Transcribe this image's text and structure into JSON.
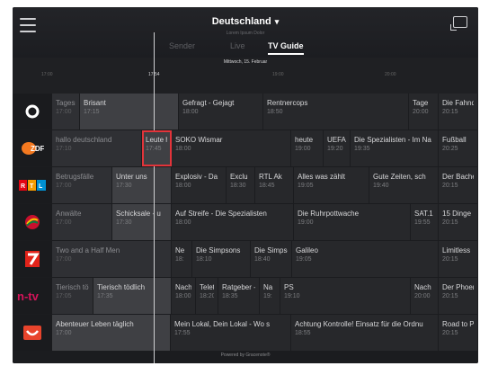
{
  "header": {
    "country": "Deutschland",
    "subline": "Lorem Ipsum Dolor",
    "tabs": [
      "Sender",
      "Live",
      "TV Guide"
    ]
  },
  "timeline": {
    "date": "Mittwoch, 15. Februar",
    "ticks": [
      "17:00",
      "17:54",
      "19:00",
      "20:00"
    ]
  },
  "channels": [
    {
      "name": "Das Erste",
      "logo_color": "#ffffff",
      "programs": [
        {
          "title": "Tagesschau",
          "time": "17:00",
          "dim": true
        },
        {
          "title": "Brisant",
          "time": "17:15"
        },
        {
          "title": "Gefragt - Gejagt",
          "time": "18:00"
        },
        {
          "title": "Rentnercops",
          "time": "18:50"
        },
        {
          "title": "Tage",
          "time": "20:00"
        },
        {
          "title": "Die Fahndung",
          "time": "20:15"
        }
      ]
    },
    {
      "name": "ZDF",
      "logo_color": "#f47920",
      "programs": [
        {
          "title": "hallo deutschland",
          "time": "17:10",
          "dim": true
        },
        {
          "title": "Leute heute",
          "time": "17:45",
          "selected": true
        },
        {
          "title": "SOKO Wismar",
          "time": "18:00"
        },
        {
          "title": "heute",
          "time": "19:00"
        },
        {
          "title": "UEFA",
          "time": "19:20"
        },
        {
          "title": "Die Spezialisten - Im Na",
          "time": "19:35"
        },
        {
          "title": "Fußball",
          "time": "20:25"
        }
      ]
    },
    {
      "name": "RTL",
      "logo_color": "#e30613",
      "programs": [
        {
          "title": "Betrugsfälle",
          "time": "17:00",
          "dim": true
        },
        {
          "title": "Unter uns",
          "time": "17:30"
        },
        {
          "title": "Explosiv - Da",
          "time": "18:00"
        },
        {
          "title": "Exclu",
          "time": "18:30"
        },
        {
          "title": "RTL Ak",
          "time": "18:45"
        },
        {
          "title": "Alles was zählt",
          "time": "19:05"
        },
        {
          "title": "Gute Zeiten, sch",
          "time": "19:40"
        },
        {
          "title": "Der Bachelor",
          "time": "20:15"
        }
      ]
    },
    {
      "name": "Sat.1",
      "logo_color": "#c8102e",
      "programs": [
        {
          "title": "Anwälte",
          "time": "17:00",
          "dim": true
        },
        {
          "title": "Schicksale - u",
          "time": "17:30"
        },
        {
          "title": "Auf Streife - Die Spezialisten",
          "time": "18:00"
        },
        {
          "title": "Die Ruhrpottwache",
          "time": "19:00"
        },
        {
          "title": "SAT.1 N",
          "time": "19:55"
        },
        {
          "title": "15 Dinge",
          "time": "20:15"
        }
      ]
    },
    {
      "name": "ProSieben",
      "logo_color": "#e2231a",
      "programs": [
        {
          "title": "Two and a Half Men",
          "time": "17:00",
          "dim": true
        },
        {
          "title": "Ne",
          "time": "18:"
        },
        {
          "title": "Die Simpsons",
          "time": "18:10"
        },
        {
          "title": "Die Simpsons",
          "time": "18:40"
        },
        {
          "title": "Galileo",
          "time": "19:05"
        },
        {
          "title": "Limitless",
          "time": "20:15"
        }
      ]
    },
    {
      "name": "n-tv",
      "logo_color": "#d4145a",
      "programs": [
        {
          "title": "Tierisch tö",
          "time": "17:05",
          "dim": true
        },
        {
          "title": "Tierisch tödlich",
          "time": "17:35"
        },
        {
          "title": "Nachric",
          "time": "18:00"
        },
        {
          "title": "Telet",
          "time": "18:20"
        },
        {
          "title": "Ratgeber -",
          "time": "18:35"
        },
        {
          "title": "Na",
          "time": "19:"
        },
        {
          "title": "PS",
          "time": "19:10"
        },
        {
          "title": "Nach",
          "time": "20:00"
        },
        {
          "title": "Der Phoenix",
          "time": "20:15"
        }
      ]
    },
    {
      "name": "RTL II",
      "logo_color": "#e8442c",
      "programs": [
        {
          "title": "Abenteuer Leben täglich",
          "time": "17:00"
        },
        {
          "title": "Mein Lokal, Dein Lokal - Wo s",
          "time": "17:55"
        },
        {
          "title": "Achtung Kontrolle! Einsatz für die Ordnu",
          "time": "18:55"
        },
        {
          "title": "Road to P",
          "time": "20:15"
        }
      ]
    }
  ],
  "footer": "Powered by Gracenote®"
}
